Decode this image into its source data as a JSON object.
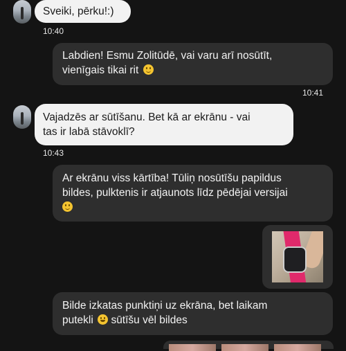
{
  "messages": [
    {
      "text": "Sveiki, pērku!:)",
      "time": "10:40"
    },
    {
      "text": "Labdien! Esmu Zolitūdē, vai varu arī nosūtīt,",
      "text2": "vienīgais tikai rit",
      "time": "10:41"
    },
    {
      "text": "Vajadzēs ar sūtīšanu. Bet kā ar ekrānu - vai",
      "text2": "tas ir labā stāvoklī?",
      "time": "10:43"
    },
    {
      "text": "Ar ekrānu viss kārtība! Tūliņ nosūtīšu papildus",
      "text2": "bildes, pulktenis ir atjaunots līdz pēdējai versijai"
    },
    {
      "text": "Bilde izkatas punktiņi uz ekrāna, bet laikam",
      "text2": "putekli",
      "text3": "sūtīšu vēl bildes"
    }
  ],
  "icons": {
    "avatar": "contact-avatar",
    "smile": "slightly-smiling-face-emoji",
    "grin": "grinning-face-emoji"
  },
  "colors": {
    "background": "#141414",
    "incoming_bubble": "#f2f2f2",
    "outgoing_bubble": "#2e2e2e"
  }
}
